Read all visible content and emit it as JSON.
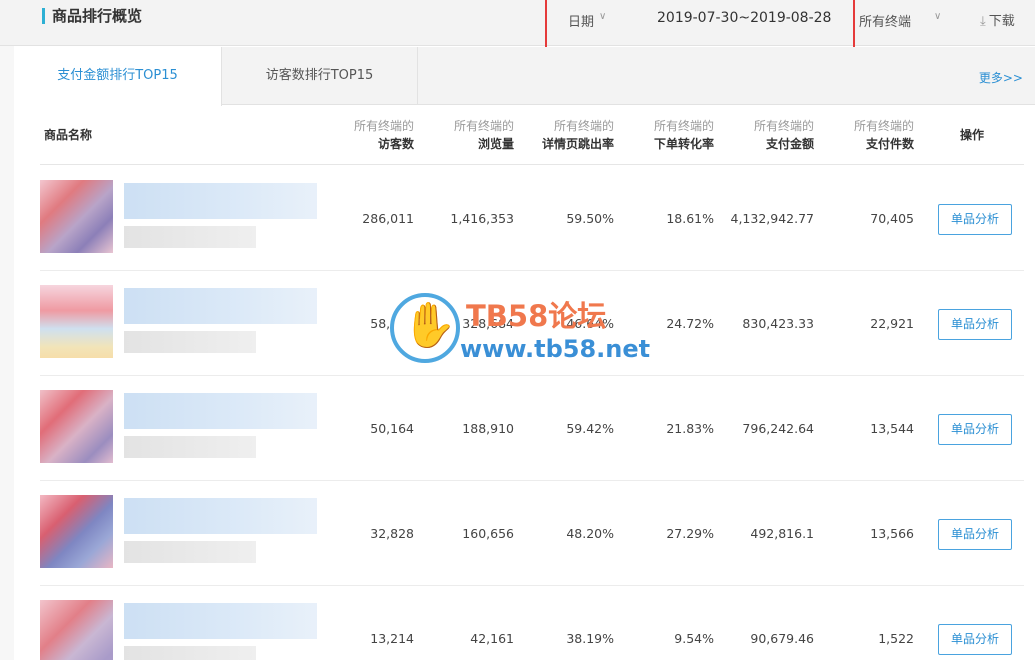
{
  "header": {
    "title": "商品排行概览",
    "date_label": "日期",
    "date_range": "2019-07-30~2019-08-28",
    "terminal_label": "所有终端",
    "download_label": "下载"
  },
  "tabs": [
    {
      "label": "支付金额排行TOP15",
      "active": true
    },
    {
      "label": "访客数排行TOP15",
      "active": false
    }
  ],
  "more_label": "更多>>",
  "columns": {
    "name": "商品名称",
    "terminal_prefix": "所有终端的",
    "visitors": "访客数",
    "views": "浏览量",
    "bounce": "详情页跳出率",
    "conversion": "下单转化率",
    "amount": "支付金额",
    "count": "支付件数",
    "op": "操作"
  },
  "rows": [
    {
      "visitors": "286,011",
      "views": "1,416,353",
      "bounce": "59.50%",
      "conversion": "18.61%",
      "amount": "4,132,942.77",
      "count": "70,405",
      "action": "单品分析"
    },
    {
      "visitors": "58,083",
      "views": "328,684",
      "bounce": "46.64%",
      "conversion": "24.72%",
      "amount": "830,423.33",
      "count": "22,921",
      "action": "单品分析"
    },
    {
      "visitors": "50,164",
      "views": "188,910",
      "bounce": "59.42%",
      "conversion": "21.83%",
      "amount": "796,242.64",
      "count": "13,544",
      "action": "单品分析"
    },
    {
      "visitors": "32,828",
      "views": "160,656",
      "bounce": "48.20%",
      "conversion": "27.29%",
      "amount": "492,816.1",
      "count": "13,566",
      "action": "单品分析"
    },
    {
      "visitors": "13,214",
      "views": "42,161",
      "bounce": "38.19%",
      "conversion": "9.54%",
      "amount": "90,679.46",
      "count": "1,522",
      "action": "单品分析"
    }
  ],
  "watermark": {
    "line1": "TB58论坛",
    "line2": "www.tb58.net"
  },
  "colors": {
    "accent": "#2b8fd3",
    "highlight_box": "#e53a3a",
    "title_bar": "#2db0d4"
  }
}
